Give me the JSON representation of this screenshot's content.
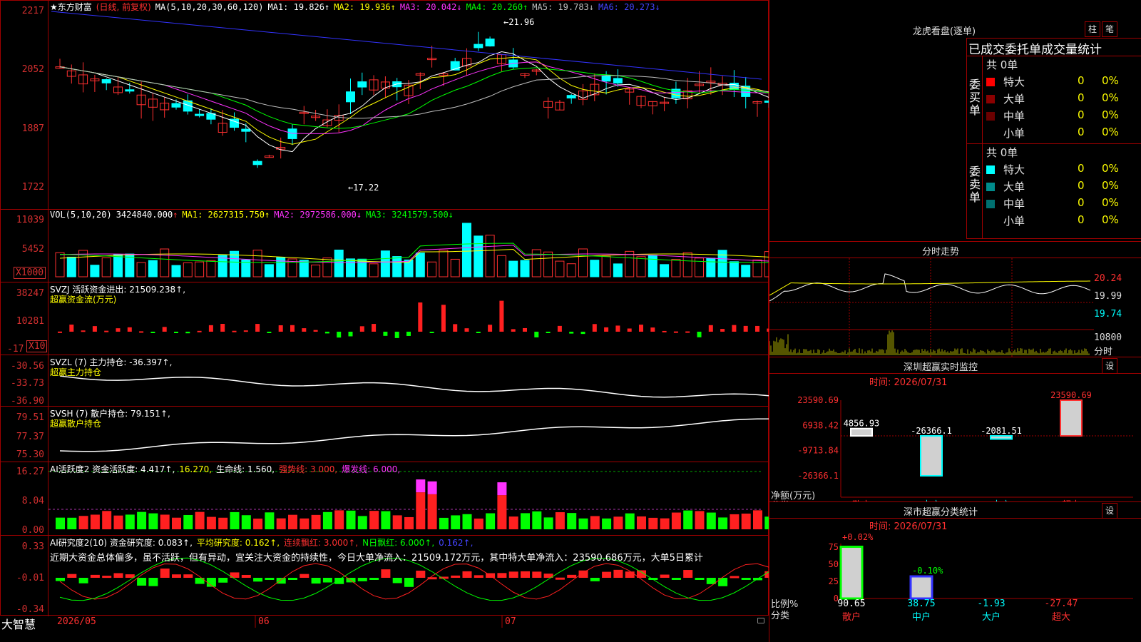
{
  "main": {
    "stock_name": "★东方财富",
    "mode": "(日线, 前复权)",
    "ma_header": "MA(5,10,20,30,60,120)",
    "ma": [
      {
        "label": "MA1:",
        "value": "19.826",
        "arrow": "↑",
        "color": "#ffffff"
      },
      {
        "label": "MA2:",
        "value": "19.936",
        "arrow": "↑",
        "color": "#ffff00"
      },
      {
        "label": "MA3:",
        "value": "20.042",
        "arrow": "↓",
        "color": "#ff33ff"
      },
      {
        "label": "MA4:",
        "value": "20.260",
        "arrow": "↑",
        "color": "#00ff00"
      },
      {
        "label": "MA5:",
        "value": "19.783",
        "arrow": "↓",
        "color": "#c0c0c0"
      },
      {
        "label": "MA6:",
        "value": "20.273",
        "arrow": "↓",
        "color": "#4444ff"
      }
    ],
    "y_ticks": [
      "2217",
      "2052",
      "1887",
      "1722"
    ],
    "high_label": "←21.96",
    "low_label": "←17.22"
  },
  "vol": {
    "header_name": "VOL(5,10,20)",
    "value": "3424840.000",
    "value_arrow": "↑",
    "ma1": "MA1: 2627315.750↑",
    "ma2": "MA2: 2972586.000↓",
    "ma3": "MA3: 3241579.500↓",
    "y_ticks": [
      "11039",
      "5452"
    ],
    "unit": "X1000"
  },
  "svzj": {
    "header": "SVZJ  活跃资金进出: 21509.238↑,",
    "sub": "超赢资金流(万元)",
    "y_ticks": [
      "38247",
      "10281",
      "-17"
    ],
    "unit": "X10"
  },
  "svzl": {
    "header": "SVZL (7) 主力持仓: -36.397↑,",
    "sub": "超赢主力持仓",
    "y_ticks": [
      "-30.56",
      "-33.73",
      "-36.90"
    ]
  },
  "svsh": {
    "header": "SVSH (7) 散户持仓: 79.151↑,",
    "sub": "超赢散户持仓",
    "y_ticks": [
      "79.51",
      "77.37",
      "75.30"
    ]
  },
  "ai1": {
    "header_a": "AI活跃度2 资金活跃度: 4.417↑,",
    "header_b": "16.270,",
    "header_c": "生命线: 1.560,",
    "header_d": "强势线: 3.000,",
    "header_e": "爆发线: 6.000,",
    "y_ticks": [
      "16.27",
      "8.04",
      "0.00"
    ]
  },
  "ai2": {
    "header_a": "AI研究度2(10) 资金研究度: 0.083↑,",
    "header_b": "平均研究度: 0.162↑,",
    "header_c": "连续飘红: 3.000↑,",
    "header_d": "N日飘红: 6.000↑,",
    "header_e": "0.162↑,",
    "comment": "近期大资金总体偏多，虽不活跃，但有异动，宜关注大资金的持续性，今日大单净流入：21509.172万元，其中特大单净流入：23590.686万元，大单5日累计",
    "y_ticks": [
      "0.33",
      "-0.01",
      "-0.34"
    ]
  },
  "bottom": {
    "brand": "大智慧",
    "dates": [
      "2026/05",
      "06",
      "07"
    ]
  },
  "side": {
    "lhb_title": "龙虎看盘(逐单)",
    "btn_zhu": "柱",
    "btn_bi": "笔",
    "table_header": "已成交委托单成交量统计",
    "buy_label": "委买单",
    "sell_label": "委卖单",
    "buy_total": "共 0单",
    "sell_total": "共 0单",
    "buy_rows": [
      {
        "name": "特大",
        "count": "0",
        "pct": "0%",
        "color": "#ff0000"
      },
      {
        "name": "大单",
        "count": "0",
        "pct": "0%",
        "color": "#8b0000"
      },
      {
        "name": "中单",
        "count": "0",
        "pct": "0%",
        "color": "#6b0000"
      },
      {
        "name": "小单",
        "count": "0",
        "pct": "0%",
        "color": ""
      }
    ],
    "sell_rows": [
      {
        "name": "特大",
        "count": "0",
        "pct": "0%",
        "color": "#00ffff"
      },
      {
        "name": "大单",
        "count": "0",
        "pct": "0%",
        "color": "#008b8b"
      },
      {
        "name": "中单",
        "count": "0",
        "pct": "0%",
        "color": "#007070"
      },
      {
        "name": "小单",
        "count": "0",
        "pct": "0%",
        "color": ""
      }
    ],
    "fs_title": "分时走势",
    "fs_prices": [
      "20.24",
      "19.99",
      "19.74"
    ],
    "fs_vol": "10800",
    "fs_vol_unit": "分时",
    "sz_title": "深圳超赢实时监控",
    "sz_btn": "设",
    "sz_time": "时间: 2026/07/31",
    "sz_y": [
      "23590.69",
      "6938.42",
      "-9713.84",
      "-26366.1"
    ],
    "sz_ylabel": "净额(万元)",
    "sz_xlabel": "分类",
    "sz_cats": [
      "散户",
      "中户",
      "大户",
      "超大"
    ],
    "sz_values": [
      "4856.93",
      "-26366.1",
      "-2081.51",
      "23590.69"
    ],
    "ss_title": "深市超赢分类统计",
    "ss_btn": "设",
    "ss_time": "时间: 2026/07/31",
    "ss_y": [
      "75",
      "50",
      "25",
      "0"
    ],
    "ss_ylabel": "比例%",
    "ss_xlabel": "分类",
    "ss_top1": "+0.02%",
    "ss_top2": "-0.10%",
    "ss_cats": [
      "散户",
      "中户",
      "大户",
      "超大"
    ],
    "ss_values": [
      "90.65",
      "38.75",
      "-1.93",
      "-27.47"
    ]
  },
  "chart_data": {
    "type": "bar",
    "title": "深圳超赢实时监控",
    "ylabel": "净额(万元)",
    "categories": [
      "散户",
      "中户",
      "大户",
      "超大"
    ],
    "values": [
      4856.93,
      -26366.1,
      -2081.51,
      23590.69
    ],
    "ylim": [
      -26366.1,
      23590.69
    ]
  }
}
